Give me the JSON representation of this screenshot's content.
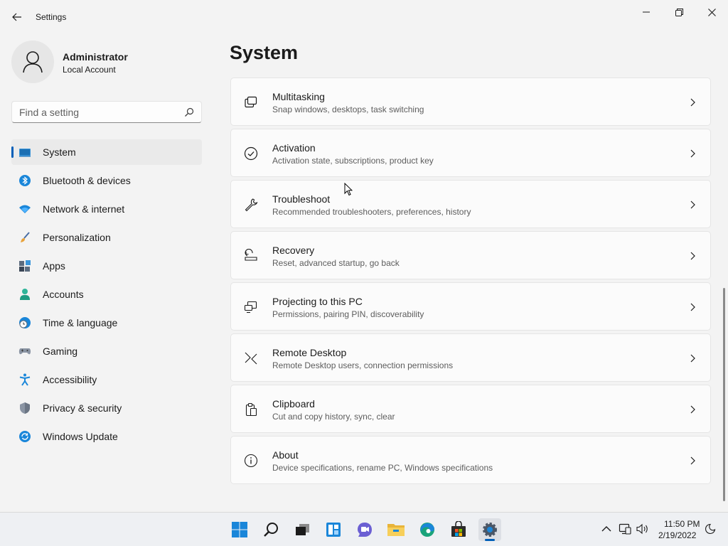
{
  "window": {
    "title": "Settings"
  },
  "user": {
    "name": "Administrator",
    "account_type": "Local Account"
  },
  "search": {
    "placeholder": "Find a setting"
  },
  "nav": {
    "selected": "System",
    "items": [
      {
        "label": "System",
        "icon": "monitor-icon"
      },
      {
        "label": "Bluetooth & devices",
        "icon": "bluetooth-icon"
      },
      {
        "label": "Network & internet",
        "icon": "wifi-icon"
      },
      {
        "label": "Personalization",
        "icon": "brush-icon"
      },
      {
        "label": "Apps",
        "icon": "apps-icon"
      },
      {
        "label": "Accounts",
        "icon": "person-icon"
      },
      {
        "label": "Time & language",
        "icon": "globe-clock-icon"
      },
      {
        "label": "Gaming",
        "icon": "gamepad-icon"
      },
      {
        "label": "Accessibility",
        "icon": "accessibility-icon"
      },
      {
        "label": "Privacy & security",
        "icon": "shield-icon"
      },
      {
        "label": "Windows Update",
        "icon": "update-icon"
      }
    ]
  },
  "main": {
    "title": "System",
    "cards": [
      {
        "title": "Multitasking",
        "subtitle": "Snap windows, desktops, task switching",
        "icon": "multitasking-icon"
      },
      {
        "title": "Activation",
        "subtitle": "Activation state, subscriptions, product key",
        "icon": "check-circle-icon"
      },
      {
        "title": "Troubleshoot",
        "subtitle": "Recommended troubleshooters, preferences, history",
        "icon": "wrench-icon"
      },
      {
        "title": "Recovery",
        "subtitle": "Reset, advanced startup, go back",
        "icon": "recovery-icon"
      },
      {
        "title": "Projecting to this PC",
        "subtitle": "Permissions, pairing PIN, discoverability",
        "icon": "projecting-icon"
      },
      {
        "title": "Remote Desktop",
        "subtitle": "Remote Desktop users, connection permissions",
        "icon": "remote-desktop-icon"
      },
      {
        "title": "Clipboard",
        "subtitle": "Cut and copy history, sync, clear",
        "icon": "clipboard-icon"
      },
      {
        "title": "About",
        "subtitle": "Device specifications, rename PC, Windows specifications",
        "icon": "info-icon"
      }
    ]
  },
  "taskbar": {
    "apps": [
      "start-icon",
      "search-icon",
      "task-view-icon",
      "widgets-icon",
      "chat-icon",
      "file-explorer-icon",
      "edge-icon",
      "store-icon",
      "settings-icon"
    ],
    "active_app": "settings-icon"
  },
  "tray": {
    "time": "11:50 PM",
    "date": "2/19/2022"
  },
  "colors": {
    "accent": "#005fb8",
    "background": "#f3f3f3",
    "card": "#fbfbfb"
  }
}
